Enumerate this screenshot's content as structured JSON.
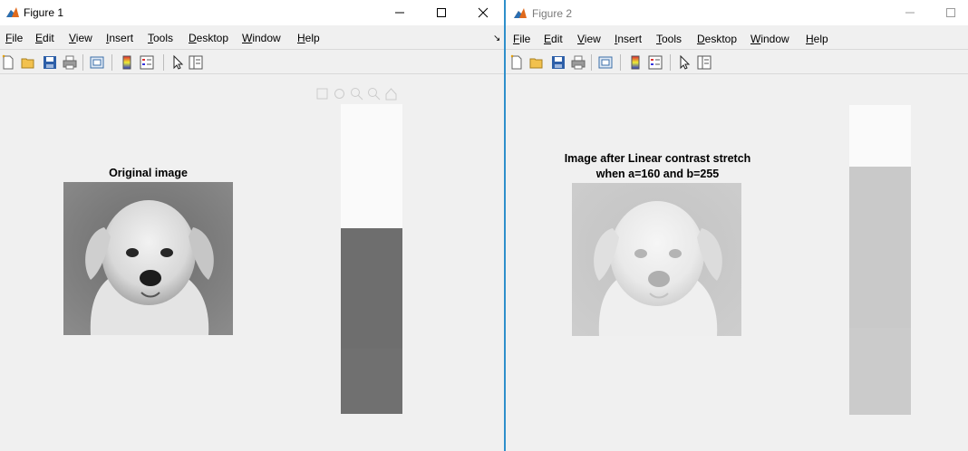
{
  "windows": [
    {
      "title": "Figure 1",
      "active": true,
      "menu": [
        "File",
        "Edit",
        "View",
        "Insert",
        "Tools",
        "Desktop",
        "Window",
        "Help"
      ],
      "menu_underline": [
        "F",
        "E",
        "V",
        "I",
        "T",
        "D",
        "W",
        "H"
      ],
      "axes_title": "Original image",
      "image_tone": "original",
      "dock_glyph": "↘",
      "colorbar": {
        "top_color": "#fafafa",
        "split": 0.4,
        "bottom_color": "#6e6e6e",
        "bottom_color_2": "#707070"
      }
    },
    {
      "title": "Figure 2",
      "active": false,
      "menu": [
        "File",
        "Edit",
        "View",
        "Insert",
        "Tools",
        "Desktop",
        "Window",
        "Help"
      ],
      "menu_underline": [
        "F",
        "E",
        "V",
        "I",
        "T",
        "D",
        "W",
        "H"
      ],
      "axes_title_line1": "Image after Linear contrast stretch",
      "axes_title_line2": "when a=160 and b=255",
      "image_tone": "stretched",
      "colorbar": {
        "top_color": "#fafafa",
        "split": 0.2,
        "bottom_color": "#c9c9c9",
        "bottom_color_2": "#cbcbcb"
      }
    }
  ],
  "toolbar_icons": [
    "new-figure-icon",
    "open-file-icon",
    "save-icon",
    "print-icon",
    "print-preview-icon",
    "colorbar-icon",
    "legend-icon",
    "edit-plot-icon",
    "property-inspector-icon"
  ],
  "axes_toolbar_icons": [
    "brush-icon",
    "pan-icon",
    "zoom-in-icon",
    "zoom-out-icon",
    "home-icon"
  ]
}
